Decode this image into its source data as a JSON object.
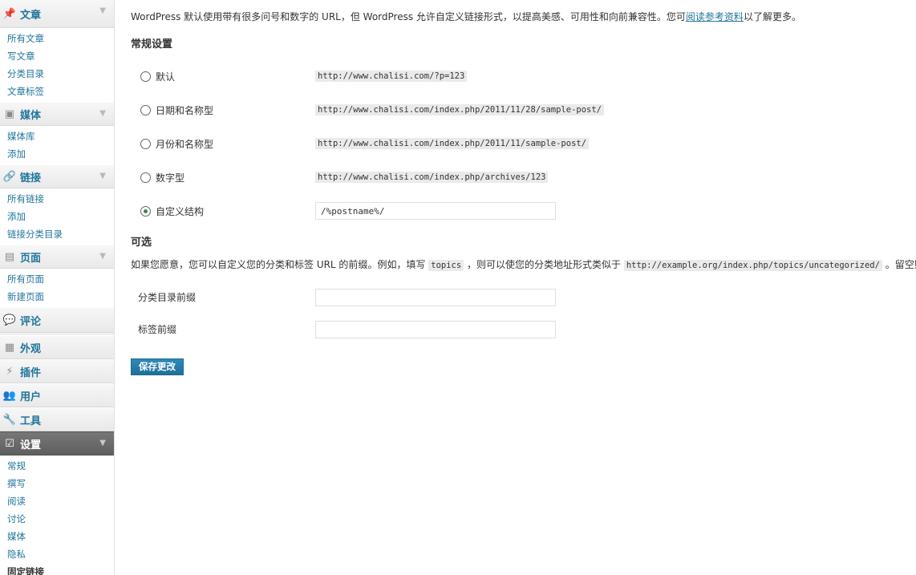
{
  "sidebar": {
    "posts": {
      "label": "文章",
      "icon": "pin-icon",
      "items": [
        "所有文章",
        "写文章",
        "分类目录",
        "文章标签"
      ]
    },
    "media": {
      "label": "媒体",
      "icon": "media-icon",
      "items": [
        "媒体库",
        "添加"
      ]
    },
    "links": {
      "label": "链接",
      "icon": "link-icon",
      "items": [
        "所有链接",
        "添加",
        "链接分类目录"
      ]
    },
    "pages": {
      "label": "页面",
      "icon": "page-icon",
      "items": [
        "所有页面",
        "新建页面"
      ]
    },
    "comments": {
      "label": "评论",
      "icon": "comment-icon"
    },
    "appearance": {
      "label": "外观",
      "icon": "appearance-icon"
    },
    "plugins": {
      "label": "插件",
      "icon": "plugin-icon"
    },
    "users": {
      "label": "用户",
      "icon": "users-icon"
    },
    "tools": {
      "label": "工具",
      "icon": "tools-icon"
    },
    "settings": {
      "label": "设置",
      "icon": "settings-icon",
      "items": [
        "常规",
        "撰写",
        "阅读",
        "讨论",
        "媒体",
        "隐私",
        "固定链接"
      ]
    }
  },
  "main": {
    "intro_before": "WordPress 默认使用带有很多问号和数字的 URL，但 WordPress 允许自定义链接形式，以提高美感、可用性和向前兼容性。您可",
    "intro_link": "阅读参考资料",
    "intro_after": "以了解更多。",
    "common_heading": "常规设置",
    "options": [
      {
        "label": "默认",
        "sample": "http://www.chalisi.com/?p=123",
        "selected": false
      },
      {
        "label": "日期和名称型",
        "sample": "http://www.chalisi.com/index.php/2011/11/28/sample-post/",
        "selected": false
      },
      {
        "label": "月份和名称型",
        "sample": "http://www.chalisi.com/index.php/2011/11/sample-post/",
        "selected": false
      },
      {
        "label": "数字型",
        "sample": "http://www.chalisi.com/index.php/archives/123",
        "selected": false
      },
      {
        "label": "自定义结构",
        "value": "/%postname%/",
        "selected": true
      }
    ],
    "optional_heading": "可选",
    "optional_desc_1": "如果您愿意，您可以自定义您的分类和标签 URL 的前缀。例如，填写 ",
    "optional_code_1": "topics",
    "optional_desc_2": " ，则可以使您的分类地址形式类似于 ",
    "optional_code_2": "http://example.org/index.php/topics/uncategorized/",
    "optional_desc_3": " 。留空则使",
    "category_base_label": "分类目录前缀",
    "category_base_value": "",
    "tag_base_label": "标签前缀",
    "tag_base_value": "",
    "save_label": "保存更改"
  }
}
